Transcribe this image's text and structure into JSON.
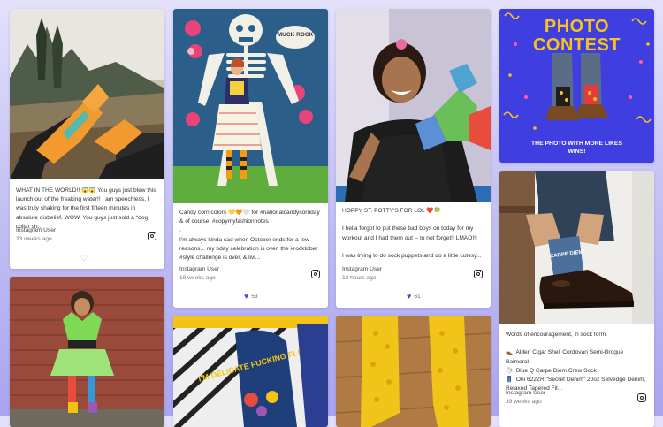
{
  "posts": [
    {
      "caption": "WHAT IN THE WORLD!! 😱😱 You guys just blew this launch out of the freaking water!! I am speechless, I was truly shaking for the first fifteen minutes in absolute disbelief. WOW. You guys just sold a *dog collar sh...",
      "user": "Instagram User",
      "time": "23 weeks ago",
      "likes": ""
    },
    {
      "caption": "Candy corn colors 💛🧡🤍 for #nationalcandycornday & of course, #copymyfashionnotes\n.\nI'm always kinda sad when October ends for a few reasons... my bday celebration is over, the #rocktober #style challenge is over, & livi...",
      "user": "Instagram User",
      "time": "19 weeks ago",
      "likes": "53"
    },
    {
      "caption": "HOPPY ST. POTTY'S FOR LOL ❤️🍀\n\nI hella forgot to put these bad boys on today for my workout and I had them out -- to not forget!! LMAO!!!\n\nI was trying to do sock puppets and do a little cutesy...",
      "user": "Instagram User",
      "time": "13 hours ago",
      "likes": "61"
    },
    {
      "caption": "Words of encouragement, in sock form.\n\n👞: Alden Cigar Shell Cordovan Semi-Brogue Balmoral\n🧦: Blue Q Carpe Diem Crew Sock\n👖: Oni 622ZR \"Secret Denim\" 20oz Selvedge Denim, Relaxed Tapered Fit...",
      "user": "Instagram User",
      "time": "39 weeks ago",
      "likes": ""
    }
  ],
  "contest": {
    "title_line1": "PHOTO",
    "title_line2": "CONTEST",
    "subtitle": "THE PHOTO WITH MORE LIKES WINS!"
  },
  "photo_text": {
    "skull_sign": "MUCK ROCK",
    "sock_text": "I'M DELICATE FUCKING FLOWER",
    "carpe_sock": "CARPE DIEM"
  },
  "colors": {
    "accent": "#4e49d6",
    "contest_bg": "#3f3ee0",
    "contest_title": "#f7c21d"
  }
}
